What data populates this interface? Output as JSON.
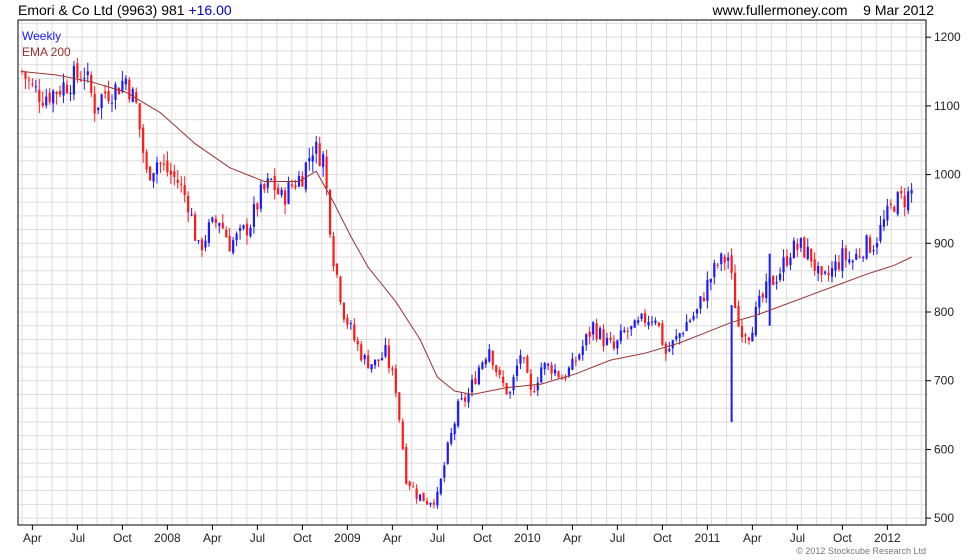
{
  "header": {
    "ticker": "Emori & Co Ltd (9963)",
    "last": "981",
    "change": "+16.00",
    "site": "www.fullermoney.com",
    "date": "9 Mar 2012"
  },
  "footer": {
    "copyright": "© 2012 Stockcube Research Ltd"
  },
  "colors": {
    "up": "#1a1aff",
    "down": "#ff1a1a",
    "ema": "#993333",
    "grid": "#dddddd",
    "frame": "#000000"
  },
  "chart_data": {
    "type": "candlestick",
    "legend": [
      "Weekly",
      "EMA 200"
    ],
    "x_ticks": [
      "Apr",
      "Jul",
      "Oct",
      "2008",
      "Apr",
      "Jul",
      "Oct",
      "2009",
      "Apr",
      "Jul",
      "Oct",
      "2010",
      "Apr",
      "Jul",
      "Oct",
      "2011",
      "Apr",
      "Jul",
      "Oct",
      "2012"
    ],
    "y_ticks": [
      500,
      600,
      700,
      800,
      900,
      1000,
      1100,
      1200
    ],
    "ylim": [
      490,
      1225
    ],
    "x_range_weeks": [
      0,
      260
    ],
    "grid": true,
    "y_axis_side": "right",
    "close_series": [
      [
        0,
        1150
      ],
      [
        3,
        1125
      ],
      [
        6,
        1115
      ],
      [
        9,
        1120
      ],
      [
        12,
        1130
      ],
      [
        15,
        1140
      ],
      [
        18,
        1150
      ],
      [
        21,
        1100
      ],
      [
        24,
        1120
      ],
      [
        27,
        1125
      ],
      [
        30,
        1140
      ],
      [
        33,
        1100
      ],
      [
        36,
        1000
      ],
      [
        39,
        1020
      ],
      [
        42,
        1005
      ],
      [
        45,
        990
      ],
      [
        48,
        960
      ],
      [
        51,
        890
      ],
      [
        54,
        920
      ],
      [
        57,
        935
      ],
      [
        60,
        900
      ],
      [
        63,
        910
      ],
      [
        66,
        930
      ],
      [
        69,
        970
      ],
      [
        72,
        990
      ],
      [
        75,
        965
      ],
      [
        78,
        985
      ],
      [
        81,
        1000
      ],
      [
        84,
        1040
      ],
      [
        87,
        1025
      ],
      [
        90,
        880
      ],
      [
        93,
        800
      ],
      [
        96,
        760
      ],
      [
        99,
        730
      ],
      [
        102,
        725
      ],
      [
        105,
        740
      ],
      [
        108,
        690
      ],
      [
        111,
        560
      ],
      [
        114,
        535
      ],
      [
        117,
        525
      ],
      [
        120,
        530
      ],
      [
        123,
        600
      ],
      [
        126,
        660
      ],
      [
        129,
        680
      ],
      [
        132,
        720
      ],
      [
        135,
        750
      ],
      [
        138,
        700
      ],
      [
        141,
        680
      ],
      [
        144,
        740
      ],
      [
        147,
        680
      ],
      [
        150,
        720
      ],
      [
        153,
        720
      ],
      [
        156,
        705
      ],
      [
        159,
        720
      ],
      [
        162,
        750
      ],
      [
        165,
        780
      ],
      [
        168,
        760
      ],
      [
        171,
        745
      ],
      [
        174,
        770
      ],
      [
        177,
        775
      ],
      [
        180,
        790
      ],
      [
        183,
        795
      ],
      [
        186,
        740
      ],
      [
        189,
        760
      ],
      [
        192,
        785
      ],
      [
        195,
        800
      ],
      [
        198,
        840
      ],
      [
        201,
        870
      ],
      [
        204,
        880
      ],
      [
        207,
        780
      ],
      [
        210,
        770
      ],
      [
        213,
        810
      ],
      [
        216,
        840
      ],
      [
        219,
        860
      ],
      [
        222,
        890
      ],
      [
        225,
        895
      ],
      [
        228,
        880
      ],
      [
        231,
        840
      ],
      [
        234,
        860
      ],
      [
        237,
        880
      ],
      [
        240,
        875
      ],
      [
        243,
        895
      ],
      [
        246,
        900
      ],
      [
        249,
        930
      ],
      [
        252,
        960
      ],
      [
        255,
        965
      ],
      [
        257,
        975
      ]
    ],
    "ema_series": [
      [
        0,
        1150
      ],
      [
        10,
        1145
      ],
      [
        20,
        1135
      ],
      [
        30,
        1120
      ],
      [
        40,
        1090
      ],
      [
        50,
        1045
      ],
      [
        60,
        1010
      ],
      [
        70,
        990
      ],
      [
        80,
        990
      ],
      [
        85,
        1005
      ],
      [
        90,
        960
      ],
      [
        95,
        910
      ],
      [
        100,
        865
      ],
      [
        108,
        815
      ],
      [
        115,
        760
      ],
      [
        120,
        705
      ],
      [
        125,
        685
      ],
      [
        130,
        680
      ],
      [
        140,
        690
      ],
      [
        150,
        695
      ],
      [
        160,
        710
      ],
      [
        170,
        730
      ],
      [
        180,
        740
      ],
      [
        190,
        755
      ],
      [
        200,
        775
      ],
      [
        205,
        785
      ],
      [
        212,
        795
      ],
      [
        220,
        810
      ],
      [
        228,
        825
      ],
      [
        236,
        840
      ],
      [
        244,
        855
      ],
      [
        252,
        868
      ],
      [
        257,
        880
      ]
    ],
    "spikes": [
      [
        205,
        640,
        810
      ],
      [
        216,
        780,
        885
      ]
    ]
  }
}
